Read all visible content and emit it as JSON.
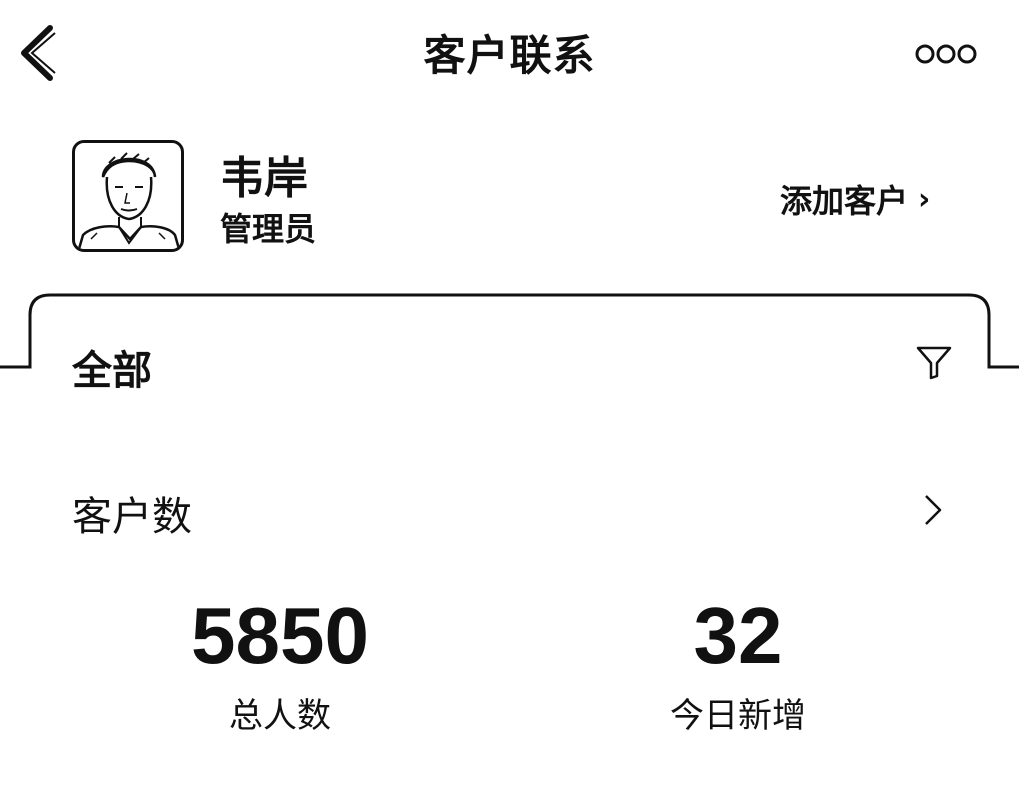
{
  "header": {
    "title": "客户联系",
    "back_icon": "chevron-left-icon",
    "more_icon": "more-horizontal-icon"
  },
  "profile": {
    "name": "韦岸",
    "role": "管理员",
    "add_customer_label": "添加客户",
    "add_customer_chevron": "›"
  },
  "card": {
    "filter_label": "全部",
    "filter_icon": "filter-icon",
    "section_title": "客户数",
    "section_icon": "chevron-right-icon",
    "stats": [
      {
        "value": "5850",
        "label": "总人数"
      },
      {
        "value": "32",
        "label": "今日新增"
      }
    ]
  }
}
